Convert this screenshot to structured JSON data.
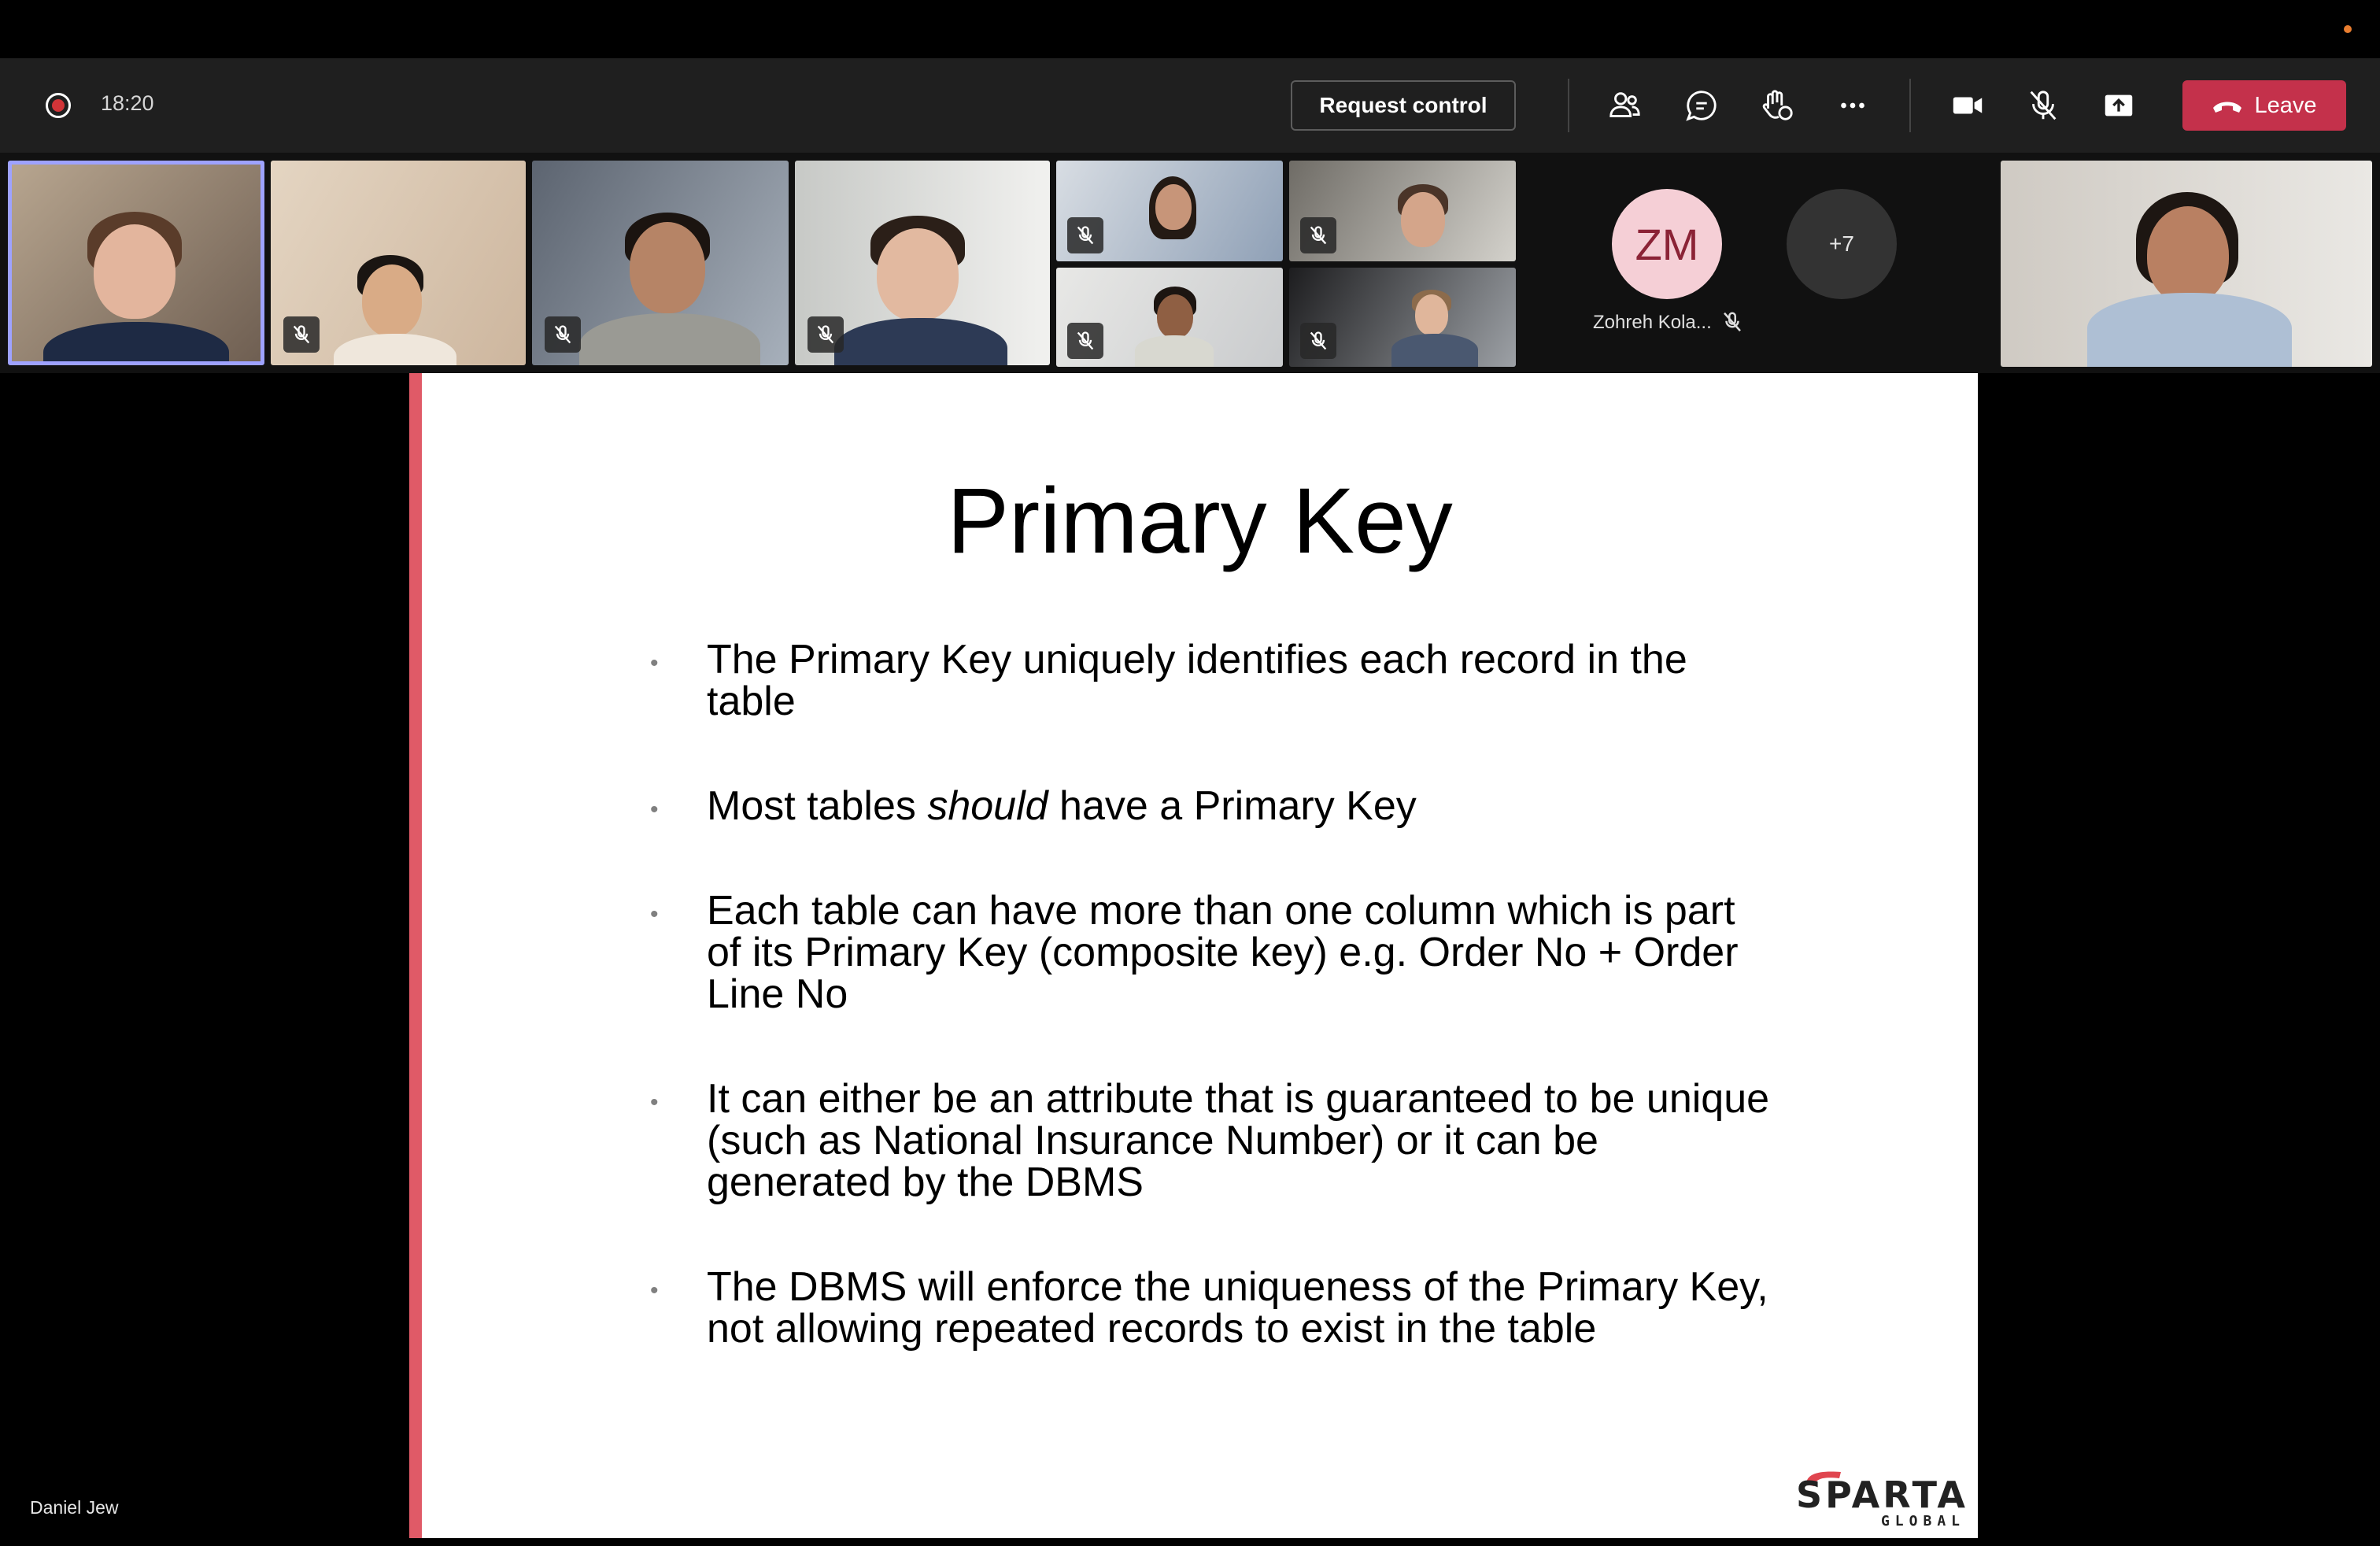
{
  "meeting": {
    "timer": "18:20",
    "request_control_label": "Request control",
    "leave_label": "Leave",
    "presenter_name": "Daniel Jew"
  },
  "toolbar_icons": [
    "record-icon",
    "people-icon",
    "chat-icon",
    "reactions-icon",
    "more-icon",
    "camera-icon",
    "mic-muted-icon",
    "share-icon",
    "hangup-icon"
  ],
  "participants": {
    "avatar_initials": "ZM",
    "avatar_name": "Zohreh Kola...",
    "overflow_label": "+7"
  },
  "slide": {
    "title": "Primary Key",
    "bullet_1": "The Primary Key uniquely identifies each record in the table",
    "bullet_2_pre": "Most tables ",
    "bullet_2_em": "should",
    "bullet_2_post": " have a Primary Key",
    "bullet_3": "Each table can have more than one column which is part of its Primary Key (composite key) e.g. Order No + Order Line No",
    "bullet_4": "It can either be an attribute that is guaranteed to be unique (such as National Insurance Number) or it can be generated by the DBMS",
    "bullet_5": "The DBMS will enforce the uniqueness of the Primary Key, not allowing repeated records to exist in the table",
    "logo_word": "SPARTA",
    "logo_sub": "GLOBAL"
  },
  "colors": {
    "accent": "#9ea2ff",
    "leave": "#c4314b",
    "slide_accent": "#e05a67",
    "avatar_bg": "#f5cfd6",
    "record": "#d13438"
  }
}
